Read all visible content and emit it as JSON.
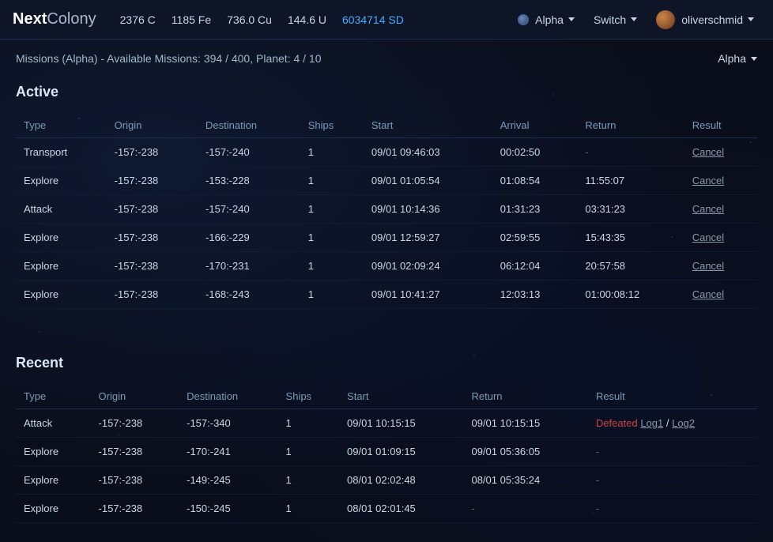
{
  "brand": {
    "part1": "Next",
    "part2": "Colony"
  },
  "navbar": {
    "resources": [
      {
        "id": "carbon",
        "value": "2376 C"
      },
      {
        "id": "iron",
        "value": "1185 Fe"
      },
      {
        "id": "copper",
        "value": "736.0 Cu"
      },
      {
        "id": "uranium",
        "value": "144.6 U"
      },
      {
        "id": "sd",
        "value": "6034714 SD",
        "highlighted": true
      }
    ],
    "planet_label": "Alpha",
    "switch_label": "Switch",
    "user_label": "oliverschmid"
  },
  "sub_header": {
    "text": "Missions (Alpha) - Available Missions: 394 / 400, Planet: 4 / 10",
    "alpha_btn": "Alpha"
  },
  "active_section": {
    "title": "Active",
    "columns": [
      "Type",
      "Origin",
      "Destination",
      "Ships",
      "Start",
      "Arrival",
      "Return",
      "Result"
    ],
    "rows": [
      {
        "type": "Transport",
        "origin": "-157:-238",
        "destination": "-157:-240",
        "ships": "1",
        "start": "09/01 09:46:03",
        "arrival": "00:02:50",
        "return": "-",
        "result": "Cancel"
      },
      {
        "type": "Explore",
        "origin": "-157:-238",
        "destination": "-153:-228",
        "ships": "1",
        "start": "09/01 01:05:54",
        "arrival": "01:08:54",
        "return": "11:55:07",
        "result": "Cancel"
      },
      {
        "type": "Attack",
        "origin": "-157:-238",
        "destination": "-157:-240",
        "ships": "1",
        "start": "09/01 10:14:36",
        "arrival": "01:31:23",
        "return": "03:31:23",
        "result": "Cancel"
      },
      {
        "type": "Explore",
        "origin": "-157:-238",
        "destination": "-166:-229",
        "ships": "1",
        "start": "09/01 12:59:27",
        "arrival": "02:59:55",
        "return": "15:43:35",
        "result": "Cancel"
      },
      {
        "type": "Explore",
        "origin": "-157:-238",
        "destination": "-170:-231",
        "ships": "1",
        "start": "09/01 02:09:24",
        "arrival": "06:12:04",
        "return": "20:57:58",
        "result": "Cancel"
      },
      {
        "type": "Explore",
        "origin": "-157:-238",
        "destination": "-168:-243",
        "ships": "1",
        "start": "09/01 10:41:27",
        "arrival": "12:03:13",
        "return": "01:00:08:12",
        "result": "Cancel"
      }
    ]
  },
  "recent_section": {
    "title": "Recent",
    "columns": [
      "Type",
      "Origin",
      "Destination",
      "Ships",
      "Start",
      "Return",
      "Result"
    ],
    "rows": [
      {
        "type": "Attack",
        "origin": "-157:-238",
        "destination": "-157:-340",
        "ships": "1",
        "start": "09/01 10:15:15",
        "return": "09/01 10:15:15",
        "result_type": "defeated",
        "result": "Defeated",
        "log1": "Log1",
        "log2": "Log2"
      },
      {
        "type": "Explore",
        "origin": "-157:-238",
        "destination": "-170:-241",
        "ships": "1",
        "start": "09/01 01:09:15",
        "return": "09/01 05:36:05",
        "result_type": "dash",
        "result": "-"
      },
      {
        "type": "Explore",
        "origin": "-157:-238",
        "destination": "-149:-245",
        "ships": "1",
        "start": "08/01 02:02:48",
        "return": "08/01 05:35:24",
        "result_type": "dash",
        "result": "-"
      },
      {
        "type": "Explore",
        "origin": "-157:-238",
        "destination": "-150:-245",
        "ships": "1",
        "start": "08/01 02:01:45",
        "return": "",
        "result_type": "dash",
        "result": "-"
      }
    ]
  }
}
